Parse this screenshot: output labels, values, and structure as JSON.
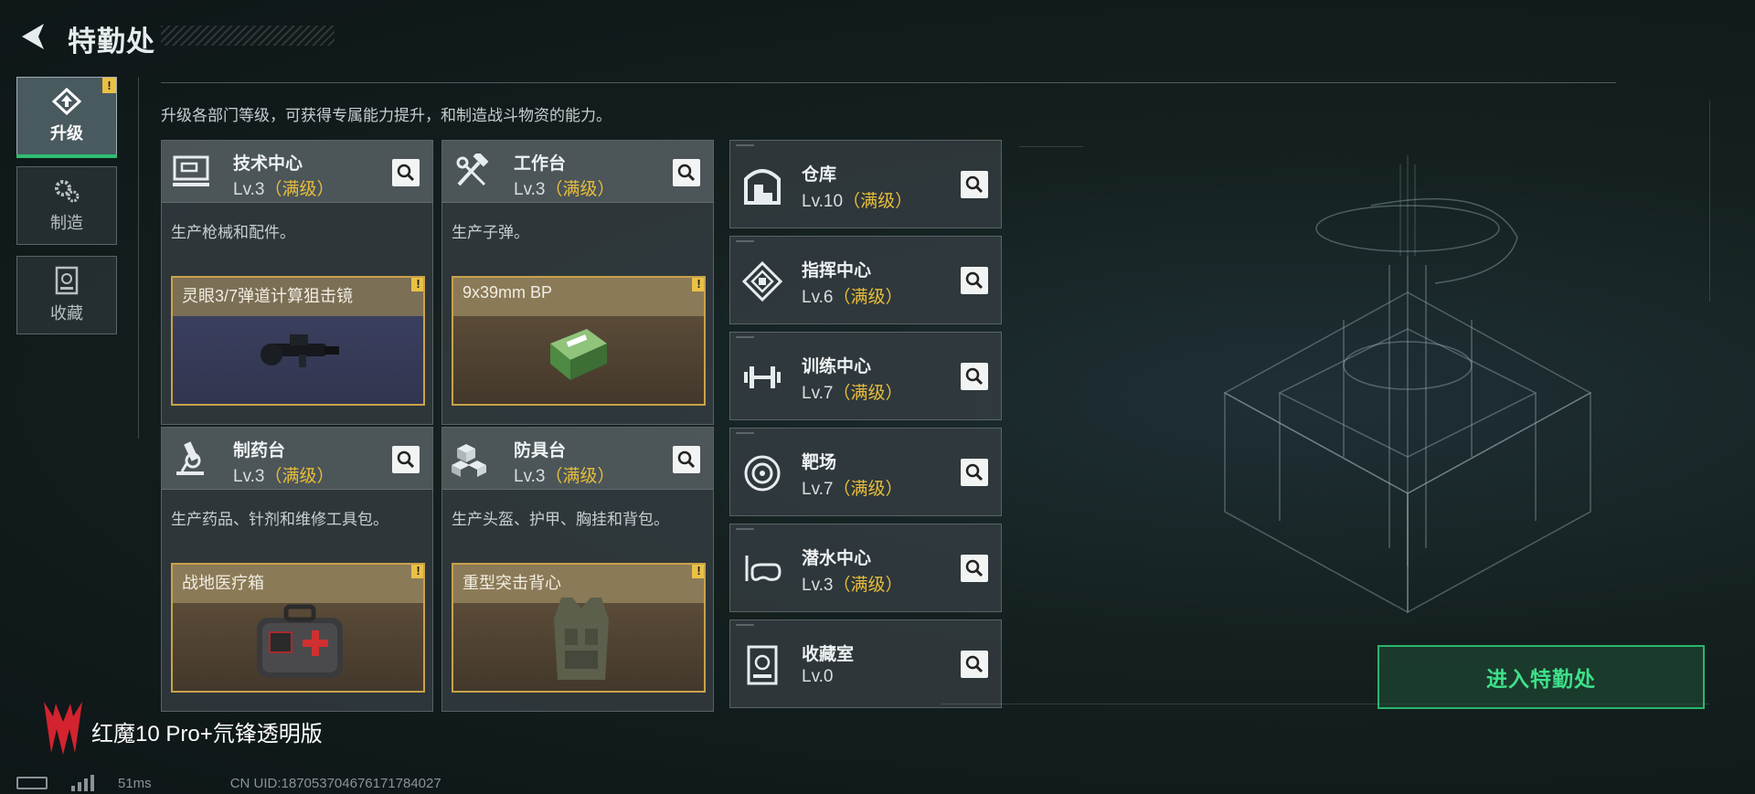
{
  "header": {
    "title": "特勤处",
    "back_icon": "back-arrow-icon"
  },
  "description": "升级各部门等级，可获得专属能力提升，和制造战斗物资的能力。",
  "tabs": [
    {
      "label": "升级",
      "icon": "upgrade-icon",
      "active": true,
      "warning": "!"
    },
    {
      "label": "制造",
      "icon": "gears-icon",
      "active": false
    },
    {
      "label": "收藏",
      "icon": "collection-icon",
      "active": false
    }
  ],
  "cards": [
    {
      "name": "技术中心",
      "level": "Lv.3",
      "max": "（满级）",
      "desc": "生产枪械和配件。",
      "item": "灵眼3/7弹道计算狙击镜",
      "warning": "!",
      "icon": "tech-center-icon",
      "item_icon": "scope-icon"
    },
    {
      "name": "工作台",
      "level": "Lv.3",
      "max": "（满级）",
      "desc": "生产子弹。",
      "item": "9x39mm BP",
      "warning": "!",
      "icon": "hammer-wrench-icon",
      "item_icon": "ammo-box-icon"
    },
    {
      "name": "制药台",
      "level": "Lv.3",
      "max": "（满级）",
      "desc": "生产药品、针剂和维修工具包。",
      "item": "战地医疗箱",
      "warning": "!",
      "icon": "microscope-icon",
      "item_icon": "medkit-icon"
    },
    {
      "name": "防具台",
      "level": "Lv.3",
      "max": "（满级）",
      "desc": "生产头盔、护甲、胸挂和背包。",
      "item": "重型突击背心",
      "warning": "!",
      "icon": "armor-blocks-icon",
      "item_icon": "vest-icon"
    }
  ],
  "facilities": [
    {
      "name": "仓库",
      "level": "Lv.10",
      "max": "（满级）",
      "icon": "warehouse-icon"
    },
    {
      "name": "指挥中心",
      "level": "Lv.6",
      "max": "（满级）",
      "icon": "command-center-icon"
    },
    {
      "name": "训练中心",
      "level": "Lv.7",
      "max": "（满级）",
      "icon": "dumbbell-icon"
    },
    {
      "name": "靶场",
      "level": "Lv.7",
      "max": "（满级）",
      "icon": "target-icon"
    },
    {
      "name": "潜水中心",
      "level": "Lv.3",
      "max": "（满级）",
      "icon": "diving-mask-icon"
    },
    {
      "name": "收藏室",
      "level": "Lv.0",
      "max": "",
      "icon": "collection-room-icon"
    }
  ],
  "enter_button": "进入特勤处",
  "watermark": "红魔10 Pro+氘锋透明版",
  "status": {
    "ping": "51ms",
    "uid": "CN UID:187053704676171784027"
  },
  "colors": {
    "accent_green": "#2bb56b",
    "max_level_gold": "#e7bd3a",
    "warning_yellow": "#e9c145"
  }
}
